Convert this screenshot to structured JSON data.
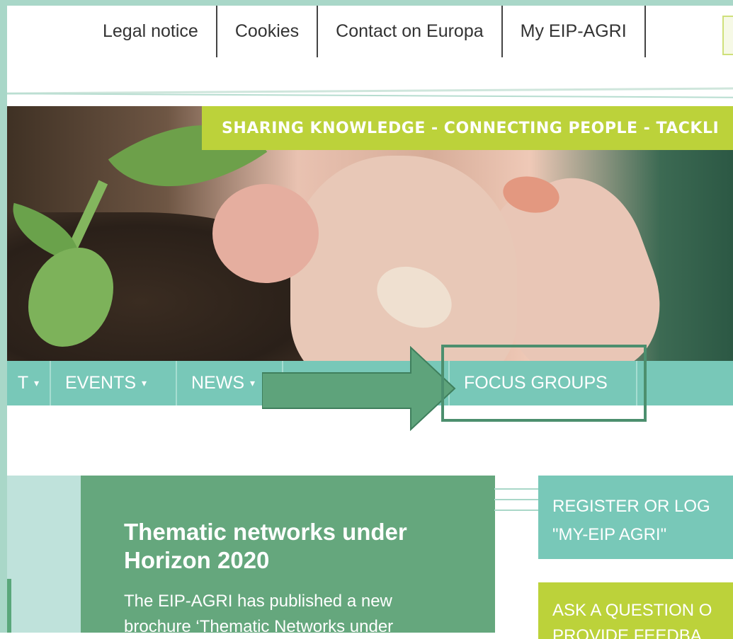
{
  "toplinks": [
    "Legal notice",
    "Cookies",
    "Contact on Europa",
    "My EIP-AGRI"
  ],
  "tagline": "SHARING KNOWLEDGE - CONNECTING PEOPLE - TACKLI",
  "nav": {
    "items": [
      {
        "label": "T",
        "caret": "▾"
      },
      {
        "label": "EVENTS",
        "caret": "▾"
      },
      {
        "label": "NEWS",
        "caret": "▾"
      },
      {
        "label": "",
        "caret": ""
      },
      {
        "label": "FOCUS GROUPS",
        "caret": ""
      }
    ]
  },
  "feature": {
    "title": "Thematic networks under Horizon 2020",
    "text": "The EIP-AGRI has published a new brochure ‘Thematic Networks under"
  },
  "sidebar": {
    "register_line1": "REGISTER OR LOG",
    "register_line2": "\"MY-EIP AGRI\"",
    "ask_line1": "ASK A QUESTION O",
    "ask_line2": "PROVIDE FEEDBA"
  },
  "colors": {
    "nav_bg": "#78c8b8",
    "tagline_bg": "#bcd23a",
    "feature_bg": "#65a77d",
    "annotation": "#4c8f6e"
  }
}
